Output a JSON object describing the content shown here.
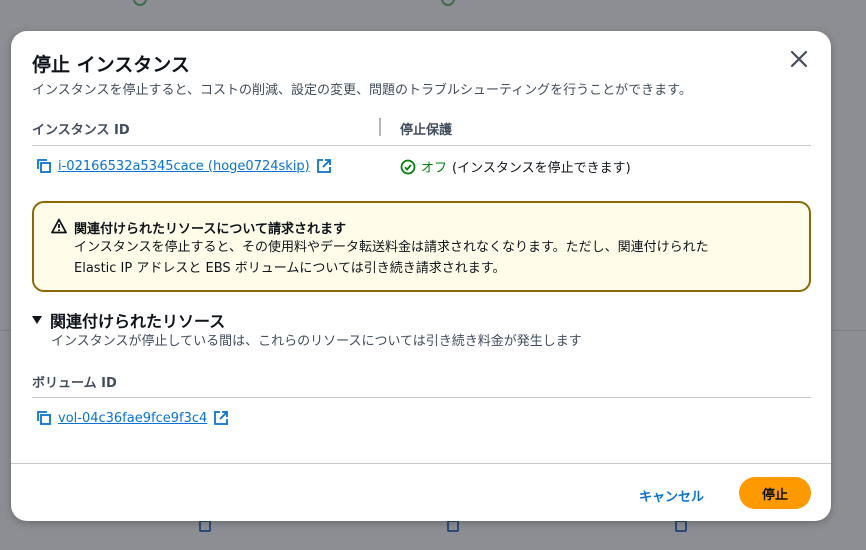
{
  "modal": {
    "title": "停止 インスタンス",
    "description": "インスタンスを停止すると、コストの削減、設定の変更、問題のトラブルシューティングを行うことができます。",
    "columns": {
      "instance_id_header": "インスタンス ID",
      "protection_header": "停止保護"
    },
    "instance": {
      "id_link": "i-02166532a5345cace (hoge0724skip)",
      "protection_status": "オフ",
      "protection_note": "(インスタンスを停止できます)"
    },
    "warning": {
      "title": "関連付けられたリソースについて請求されます",
      "body_line1": "インスタンスを停止すると、その使用料やデータ転送料金は請求されなくなります。ただし、関連付けられた",
      "body_line2": "Elastic IP アドレスと EBS ボリュームについては引き続き請求されます。"
    },
    "related": {
      "title": "関連付けられたリソース",
      "description": "インスタンスが停止している間は、これらのリソースについては引き続き料金が発生します",
      "volume_header": "ボリューム ID",
      "volume_link": "vol-04c36fae9fce9f3c4"
    },
    "buttons": {
      "cancel": "キャンセル",
      "stop": "停止"
    }
  },
  "colors": {
    "link": "#0972d3",
    "primary_button": "#ff9900",
    "warning_border": "#8d6605",
    "warning_bg": "#fffce9",
    "success": "#037f0c"
  },
  "icons": [
    "close-icon",
    "copy-icon",
    "external-link-icon",
    "check-circle-icon",
    "warning-icon",
    "caret-down-icon"
  ]
}
